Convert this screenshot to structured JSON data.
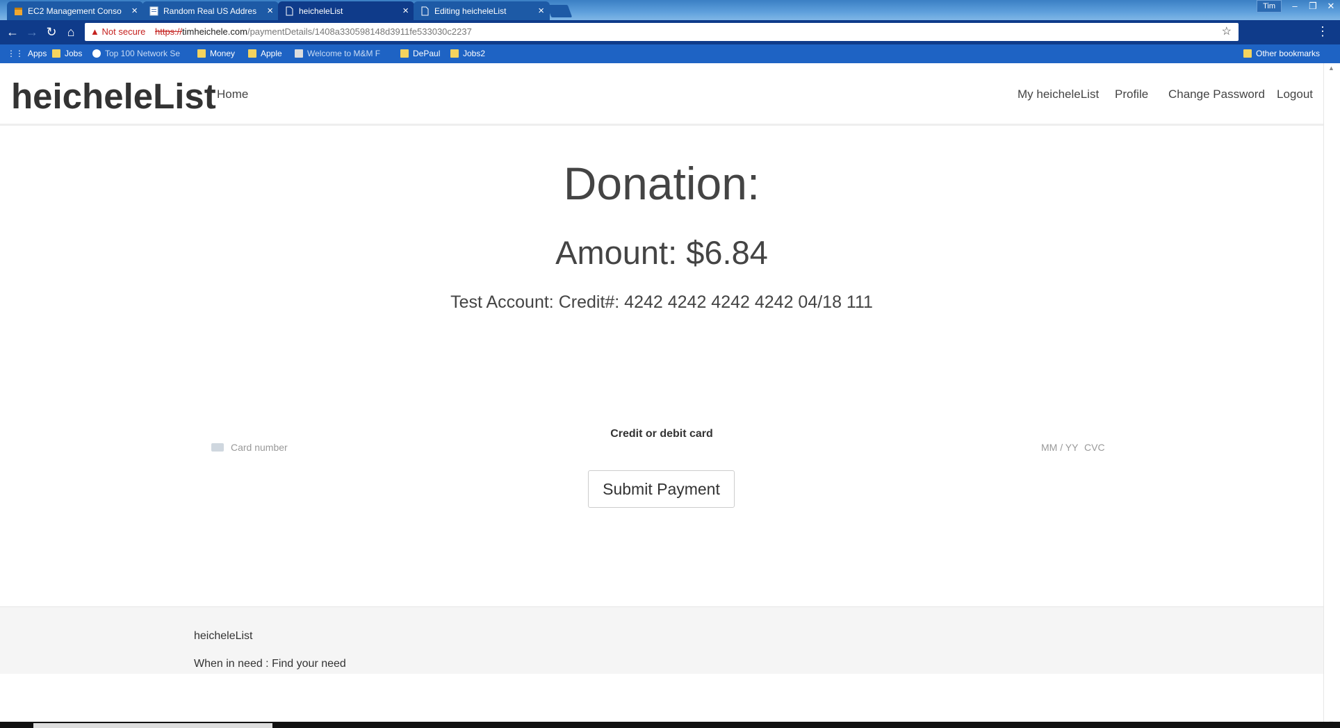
{
  "browser": {
    "tabs": [
      {
        "title": "EC2 Management Conso",
        "icon": "box-icon",
        "active": false
      },
      {
        "title": "Random Real US Addres",
        "icon": "page-icon",
        "active": false
      },
      {
        "title": "heicheleList",
        "icon": "document-icon",
        "active": true
      },
      {
        "title": "Editing heicheleList",
        "icon": "document-icon",
        "active": false
      }
    ],
    "user_label": "Tim",
    "security_label": "Not secure",
    "url_protocol": "https://",
    "url_host": "timheichele.com",
    "url_path": "/paymentDetails/1408a330598148d3911fe533030c2237",
    "bookmarks": [
      "Apps",
      "Jobs",
      "Top 100 Network Se",
      "Money",
      "Apple",
      "Welcome to M&M F",
      "DePaul",
      "Jobs2"
    ],
    "other_bookmarks": "Other bookmarks"
  },
  "navbar": {
    "brand": "heicheleList",
    "home": "Home",
    "my_list": "My heicheleList",
    "profile": "Profile",
    "change_password": "Change Password",
    "logout": "Logout"
  },
  "main": {
    "title": "Donation:",
    "amount": "Amount: $6.84",
    "test_account": "Test Account: Credit#: 4242 4242 4242 4242 04/18 111",
    "card_label": "Credit or debit card",
    "card_number_placeholder": "Card number",
    "expiry_placeholder": "MM / YY",
    "cvc_placeholder": "CVC",
    "submit_label": "Submit Payment"
  },
  "footer": {
    "brand": "heicheleList",
    "tagline": "When in need : Find your need"
  },
  "colors": {
    "tab_bar": "#3b7fc4",
    "address_bar": "#0f3b8a",
    "bookmarks_bar": "#1e63c4",
    "brand_text": "#333333",
    "not_secure": "#c5221f"
  }
}
